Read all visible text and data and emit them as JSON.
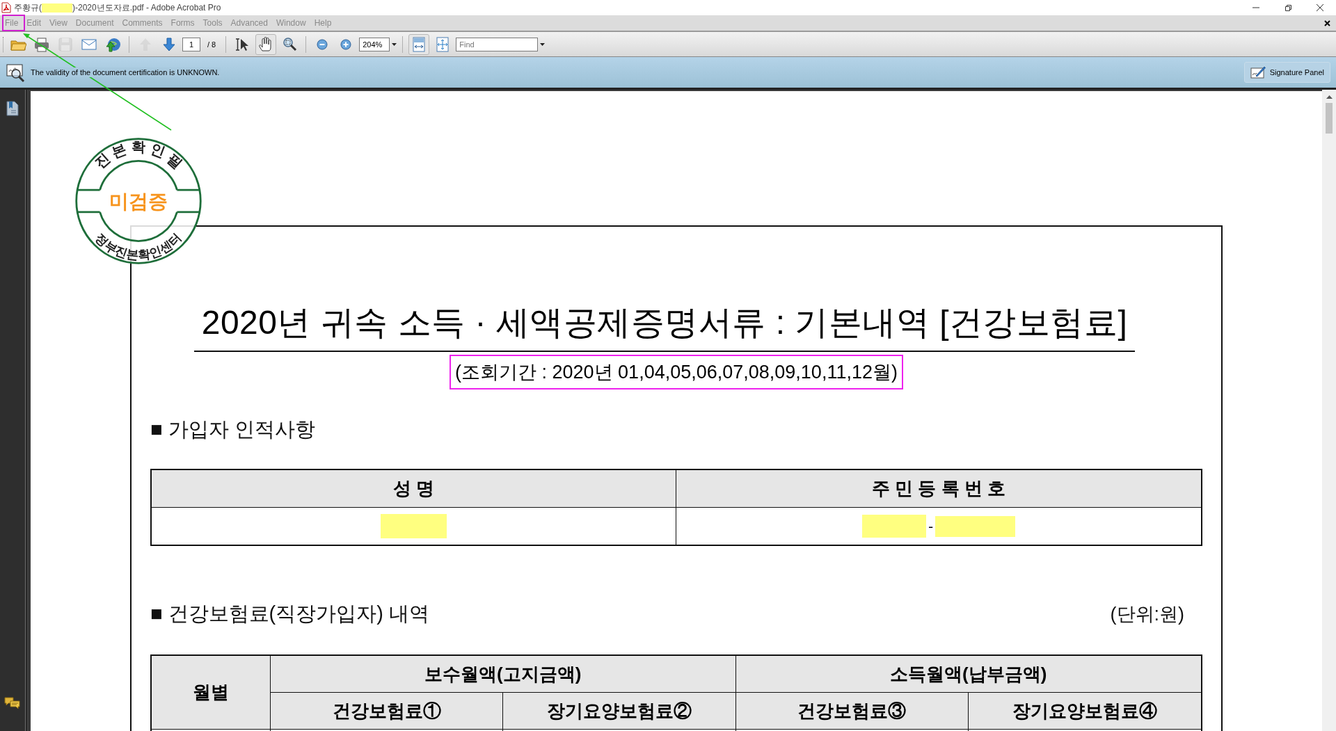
{
  "window": {
    "title_prefix": "주황규(",
    "title_suffix": ")-2020년도자료.pdf - Adobe Acrobat Pro"
  },
  "menu": [
    "File",
    "Edit",
    "View",
    "Document",
    "Comments",
    "Forms",
    "Tools",
    "Advanced",
    "Window",
    "Help"
  ],
  "toolbar": [
    {
      "kind": "open",
      "selected": false,
      "disabled": false
    },
    {
      "kind": "print",
      "selected": false,
      "disabled": false
    },
    {
      "kind": "save",
      "selected": false,
      "disabled": true
    },
    {
      "kind": "email",
      "selected": false,
      "disabled": false
    },
    {
      "kind": "web",
      "selected": false,
      "disabled": false
    },
    {
      "kind": "separator"
    },
    {
      "kind": "prev",
      "selected": false,
      "disabled": true
    },
    {
      "kind": "next",
      "selected": false,
      "disabled": false
    },
    {
      "kind": "page",
      "value": "1",
      "total": "/ 8"
    },
    {
      "kind": "separator"
    },
    {
      "kind": "select",
      "selected": false,
      "disabled": false
    },
    {
      "kind": "hand",
      "selected": true,
      "disabled": false
    },
    {
      "kind": "zoomtool",
      "selected": false,
      "disabled": false
    },
    {
      "kind": "separator"
    },
    {
      "kind": "zoomout",
      "selected": false,
      "disabled": false
    },
    {
      "kind": "zoomin",
      "selected": false,
      "disabled": false
    },
    {
      "kind": "zoom",
      "value": "204%"
    },
    {
      "kind": "separator"
    },
    {
      "kind": "fitwidth",
      "selected": true,
      "disabled": false
    },
    {
      "kind": "fitpage",
      "selected": false,
      "disabled": false
    },
    {
      "kind": "find",
      "placeholder": "Find"
    }
  ],
  "cert_bar": {
    "message": "The validity of the document certification is UNKNOWN.",
    "button": "Signature Panel"
  },
  "stamp": {
    "top": "진 본 확 인 필",
    "center": "미검증",
    "bottom": "정부진본확인센터"
  },
  "document": {
    "title": "2020년 귀속 소득 · 세액공제증명서류 : 기본내역 [건강보험료]",
    "period": "(조회기간 : 2020년 01,04,05,06,07,08,09,10,11,12월)",
    "section1": "■ 가입자 인적사항",
    "person_table": {
      "columns": [
        "성 명",
        "주 민 등 록 번 호"
      ],
      "id_separator": "-"
    },
    "section2": "■ 건강보험료(직장가입자) 내역",
    "unit": "(단위:원)",
    "fee_table": {
      "month_header": "월별",
      "groups": [
        {
          "label": "보수월액(고지금액)",
          "columns": [
            "건강보험료①",
            "장기요양보험료②"
          ]
        },
        {
          "label": "소득월액(납부금액)",
          "columns": [
            "건강보험료③",
            "장기요양보험료④"
          ]
        }
      ]
    }
  }
}
